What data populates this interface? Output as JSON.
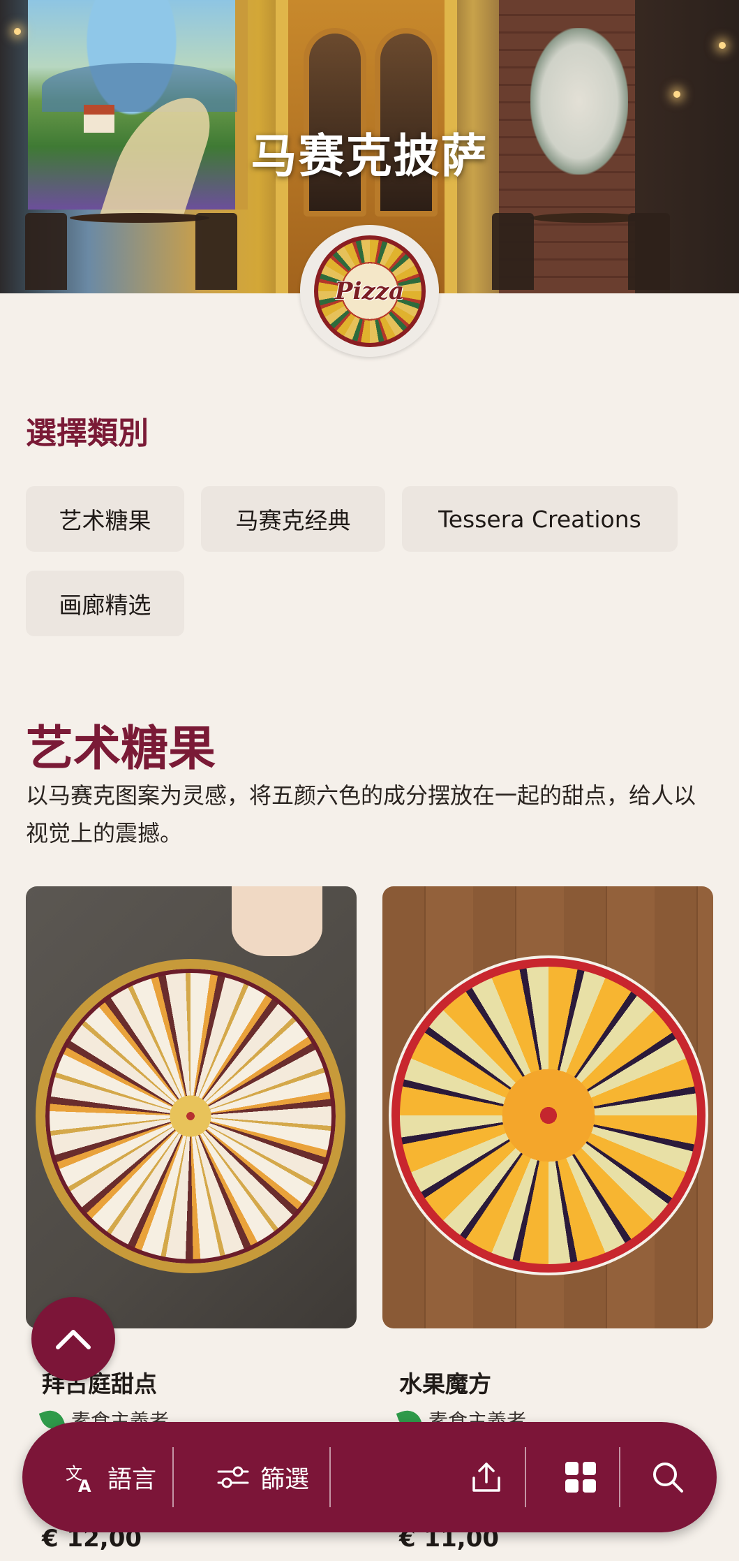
{
  "restaurant": {
    "name": "马赛克披萨",
    "logo_text": "Pizza"
  },
  "categories": {
    "heading": "選擇類別",
    "items": [
      {
        "label": "艺术糖果"
      },
      {
        "label": "马赛克经典"
      },
      {
        "label": "Tessera Creations"
      },
      {
        "label": "画廊精选"
      }
    ]
  },
  "section": {
    "title": "艺术糖果",
    "description": "以马赛克图案为灵感，将五颜六色的成分摆放在一起的甜点，给人以视觉上的震撼。"
  },
  "products": [
    {
      "name": "拜占庭甜点",
      "diet": "素食主義者",
      "price": "€ 12,00"
    },
    {
      "name": "水果魔方",
      "diet": "素食主義者",
      "price": "€ 11,00"
    }
  ],
  "bottom_bar": {
    "language_label": "語言",
    "filter_label": "篩選",
    "icons": [
      "translate-icon",
      "filter-icon",
      "share-icon",
      "grid-icon",
      "search-icon"
    ]
  },
  "colors": {
    "accent": "#7c1538",
    "heading": "#7a1a36",
    "background": "#f5f0ea",
    "chip": "#ece6e0"
  }
}
